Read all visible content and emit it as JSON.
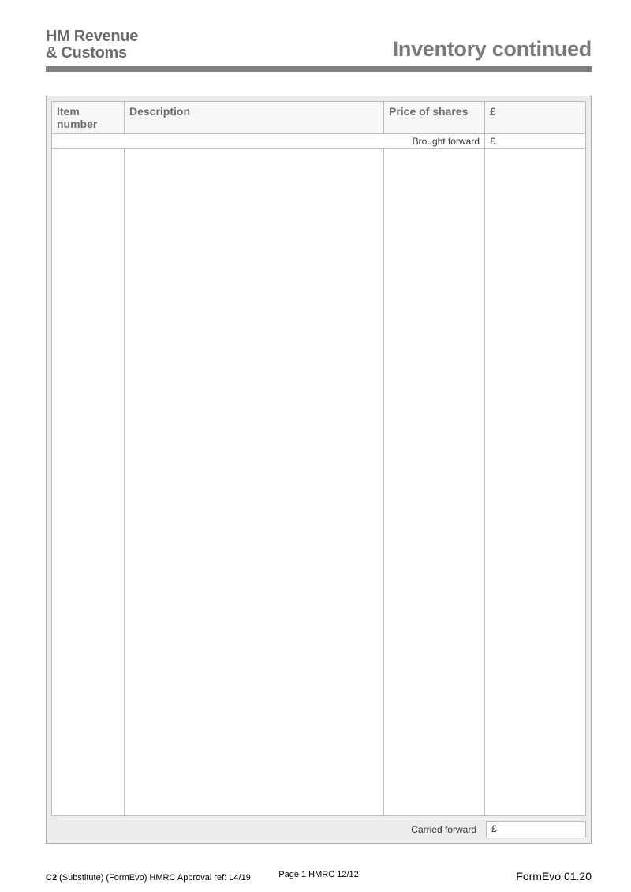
{
  "header": {
    "logo_line1": "HM Revenue",
    "logo_line2": "& Customs",
    "title": "Inventory continued"
  },
  "table": {
    "headers": {
      "item_number": "Item number",
      "description": "Description",
      "price_of_shares": "Price of shares",
      "currency": "£"
    },
    "brought_forward": {
      "label": "Brought forward",
      "currency": "£",
      "value": ""
    },
    "carried_forward": {
      "label": "Carried forward",
      "currency": "£",
      "value": ""
    }
  },
  "footer": {
    "left_bold": "C2",
    "left_rest": " (Substitute) (FormEvo) HMRC Approval ref: L4/19",
    "center": "Page 1  HMRC 12/12",
    "right": "FormEvo 01.20"
  }
}
